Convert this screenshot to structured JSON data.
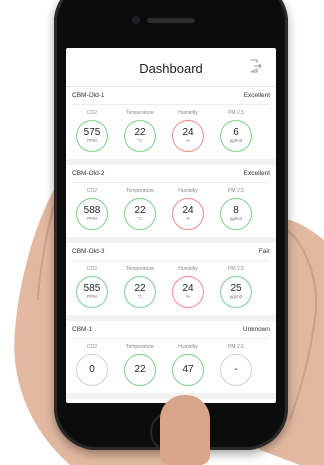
{
  "app": {
    "title": "Dashboard",
    "logout_icon": "logout-icon"
  },
  "metric_labels": [
    "CO2",
    "Temperature",
    "Humidity",
    "PM 2.5"
  ],
  "devices": [
    {
      "name": "CBM-Old-1",
      "status": "Excellent",
      "metrics": [
        {
          "value": "575",
          "unit": "PPM",
          "ring": "green"
        },
        {
          "value": "22",
          "unit": "°C",
          "ring": "green"
        },
        {
          "value": "24",
          "unit": "%",
          "ring": "red"
        },
        {
          "value": "6",
          "unit": "µg/m3",
          "ring": "green"
        }
      ]
    },
    {
      "name": "CBM-Old-2",
      "status": "Excellent",
      "metrics": [
        {
          "value": "588",
          "unit": "PPM",
          "ring": "green"
        },
        {
          "value": "22",
          "unit": "°C",
          "ring": "green"
        },
        {
          "value": "24",
          "unit": "%",
          "ring": "red"
        },
        {
          "value": "8",
          "unit": "µg/m3",
          "ring": "green"
        }
      ]
    },
    {
      "name": "CBM-Old-3",
      "status": "Fair",
      "metrics": [
        {
          "value": "585",
          "unit": "PPM",
          "ring": "green"
        },
        {
          "value": "22",
          "unit": "°C",
          "ring": "green"
        },
        {
          "value": "24",
          "unit": "%",
          "ring": "red"
        },
        {
          "value": "25",
          "unit": "µg/m3",
          "ring": "green"
        }
      ]
    },
    {
      "name": "CBM-1",
      "status": "Unknown",
      "metrics": [
        {
          "value": "0",
          "unit": "",
          "ring": "grey"
        },
        {
          "value": "22",
          "unit": "",
          "ring": "green"
        },
        {
          "value": "47",
          "unit": "",
          "ring": "green"
        },
        {
          "value": "-",
          "unit": "",
          "ring": "grey"
        }
      ]
    }
  ],
  "colors": {
    "good": "#7bcf8a",
    "bad": "#ef8c8c",
    "neutral": "#d0d0d0"
  }
}
